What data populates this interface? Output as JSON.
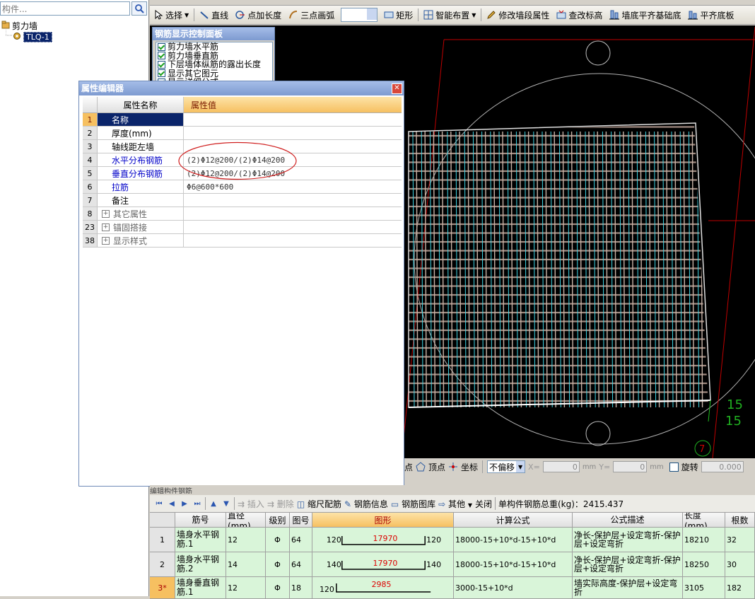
{
  "left_panel": {
    "search_placeholder": "构件...",
    "tree_root": "剪力墙",
    "tree_child": "TLQ-1"
  },
  "toolbar": {
    "select": "选择",
    "line": "直线",
    "point_length": "点加长度",
    "three_point_arc": "三点画弧",
    "rect": "矩形",
    "smart_layout": "智能布置",
    "modify_wall_segment": "修改墙段属性",
    "check_elevation": "查改标高",
    "wall_bottom_align": "墙底平齐基础底",
    "align_slab_bottom": "平齐底板"
  },
  "control_panel": {
    "title": "钢筋显示控制面板",
    "items": [
      "剪力墙水平筋",
      "剪力墙垂直筋",
      "下层墙体纵筋的露出长度",
      "显示其它图元",
      "显示详细公式"
    ]
  },
  "property_editor": {
    "title": "属性编辑器",
    "header_name": "属性名称",
    "header_value": "属性值",
    "rows": [
      {
        "num": "1",
        "name": "名称",
        "value": ""
      },
      {
        "num": "2",
        "name": "厚度(mm)",
        "value": ""
      },
      {
        "num": "3",
        "name": "轴线距左墙",
        "value": ""
      },
      {
        "num": "4",
        "name": "水平分布钢筋",
        "value": "(2)Φ12@200/(2)Φ14@200"
      },
      {
        "num": "5",
        "name": "垂直分布钢筋",
        "value": "(2)Φ12@200/(2)Φ14@200"
      },
      {
        "num": "6",
        "name": "拉筋",
        "value": "Φ6@600*600"
      },
      {
        "num": "7",
        "name": "备注",
        "value": ""
      },
      {
        "num": "8",
        "name": "其它属性",
        "value": ""
      },
      {
        "num": "23",
        "name": "锚固搭接",
        "value": ""
      },
      {
        "num": "38",
        "name": "显示样式",
        "value": ""
      }
    ]
  },
  "canvas": {
    "label_a": "15",
    "label_b": "15",
    "axis_label": "7"
  },
  "status_row": {
    "point": "点",
    "vertex": "顶点",
    "coord": "坐标",
    "offset": "不偏移",
    "x_label": "X=",
    "x_value": "0",
    "y_label": "Y=",
    "y_value": "0",
    "unit_x": "mm",
    "unit_y": "mm",
    "rotate": "旋转",
    "rotate_value": "0.000"
  },
  "rebar_toolbar": {
    "title": "编辑构件钢筋",
    "insert": "插入",
    "delete": "删除",
    "scale": "缩尺配筋",
    "info": "钢筋信息",
    "library": "钢筋图库",
    "other": "其他",
    "close": "关闭",
    "total": "单构件钢筋总重(kg)：2415.437"
  },
  "rebar_table": {
    "headers": [
      "筋号",
      "直径(mm)",
      "级别",
      "图号",
      "图形",
      "计算公式",
      "公式描述",
      "长度(mm)",
      "根数"
    ],
    "rows": [
      {
        "row": "1",
        "name": "墙身水平钢筋.1",
        "dia": "12",
        "grade": "Φ",
        "fig": "64",
        "left": "120",
        "mid": "17970",
        "right": "120",
        "formula": "18000-15+10*d-15+10*d",
        "desc": "净长-保护层+设定弯折-保护层+设定弯折",
        "len": "18210",
        "count": "32"
      },
      {
        "row": "2",
        "name": "墙身水平钢筋.2",
        "dia": "14",
        "grade": "Φ",
        "fig": "64",
        "left": "140",
        "mid": "17970",
        "right": "140",
        "formula": "18000-15+10*d-15+10*d",
        "desc": "净长-保护层+设定弯折-保护层+设定弯折",
        "len": "18250",
        "count": "30"
      },
      {
        "row": "3*",
        "name": "墙身垂直钢筋.1",
        "dia": "12",
        "grade": "Φ",
        "fig": "18",
        "left": "120",
        "mid": "2985",
        "right": "",
        "formula": "3000-15+10*d",
        "desc": "墙实际高度-保护层+设定弯折",
        "len": "3105",
        "count": "182"
      }
    ]
  }
}
